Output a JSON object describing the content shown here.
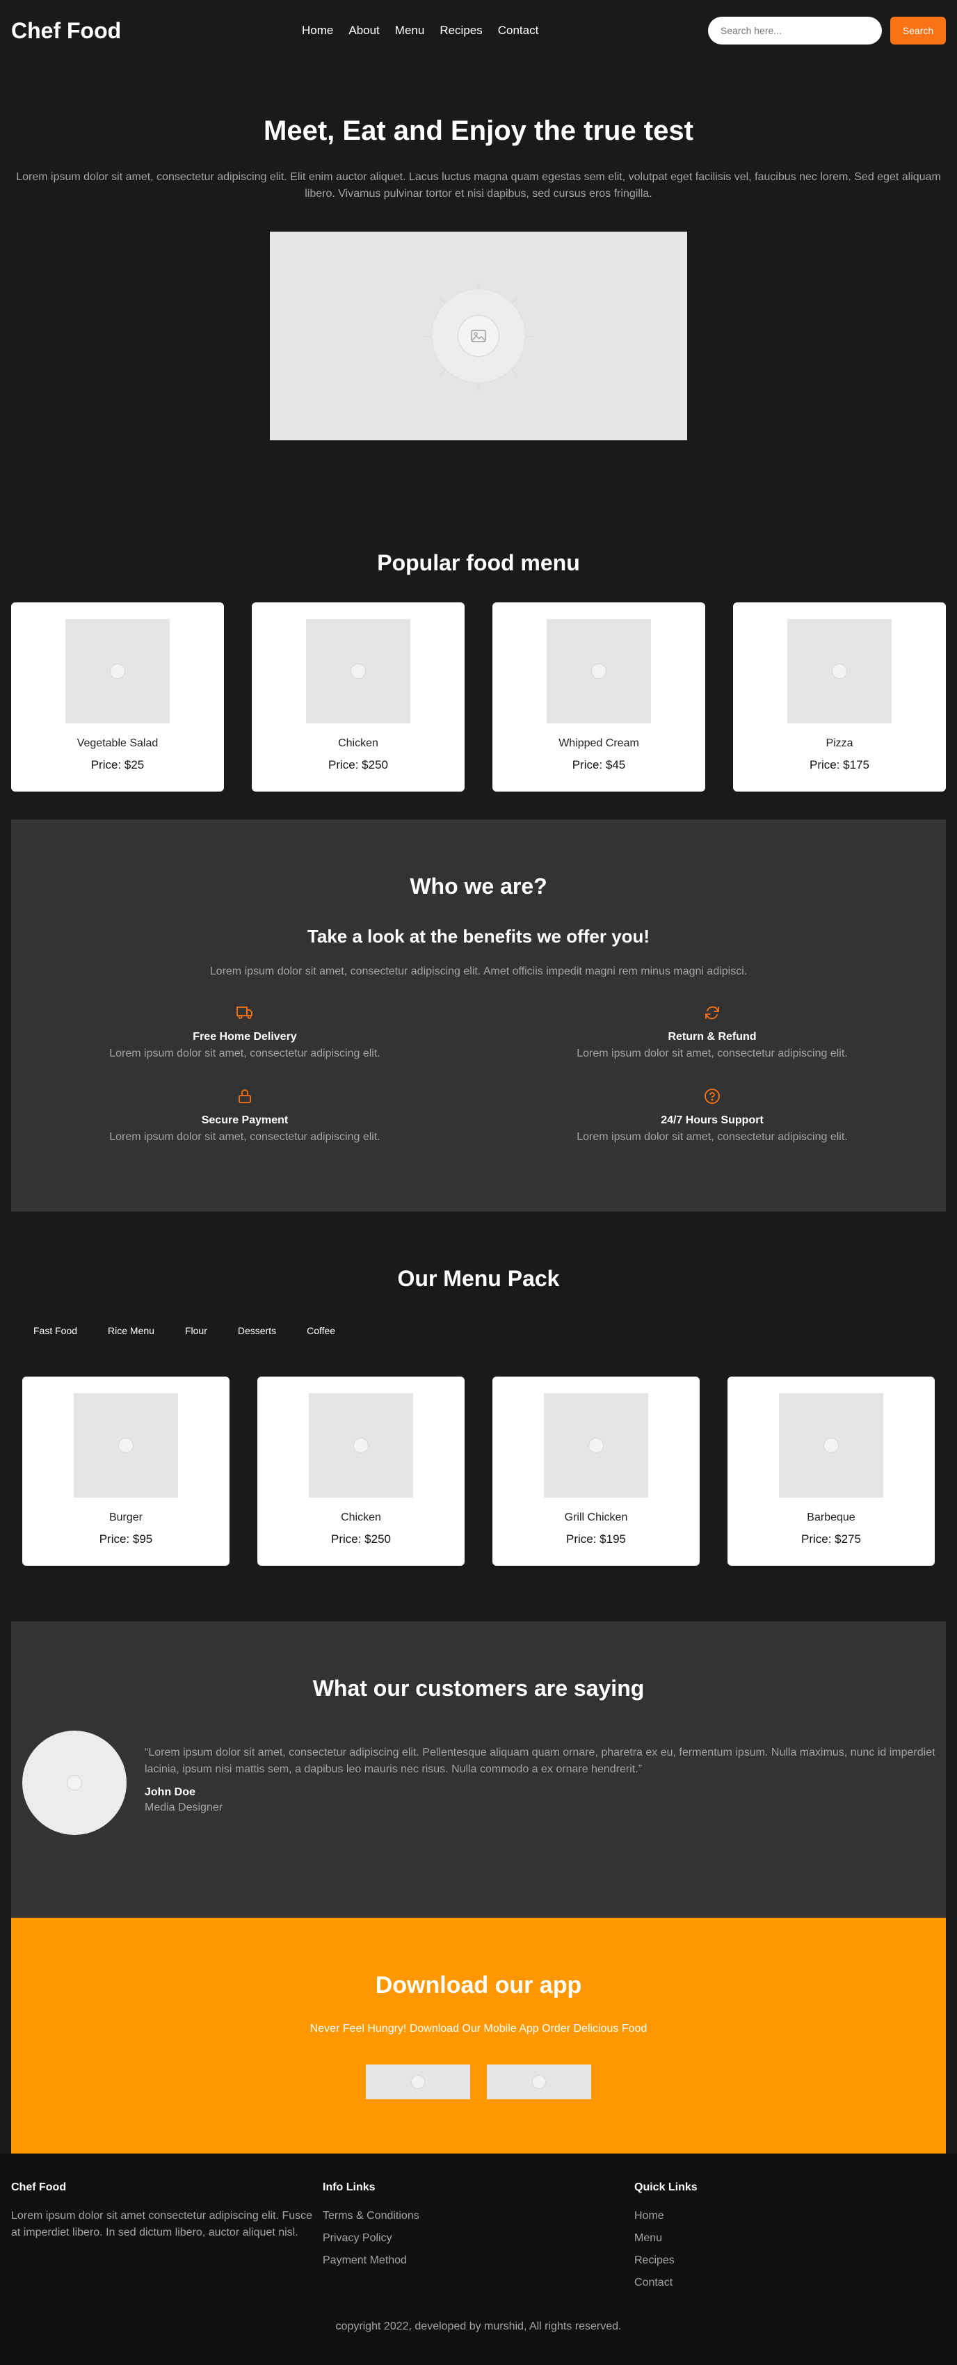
{
  "brand": "Chef Food",
  "nav": [
    "Home",
    "About",
    "Menu",
    "Recipes",
    "Contact"
  ],
  "search": {
    "placeholder": "Search here...",
    "button": "Search"
  },
  "hero": {
    "title": "Meet, Eat and Enjoy the true test",
    "text": "Lorem ipsum dolor sit amet, consectetur adipiscing elit. Elit enim auctor aliquet. Lacus luctus magna quam egestas sem elit, volutpat eget facilisis vel, faucibus nec lorem. Sed eget aliquam libero. Vivamus pulvinar tortor et nisi dapibus, sed cursus eros fringilla."
  },
  "popular": {
    "title": "Popular food menu",
    "items": [
      {
        "name": "Vegetable Salad",
        "price": "Price: $25"
      },
      {
        "name": "Chicken",
        "price": "Price: $250"
      },
      {
        "name": "Whipped Cream",
        "price": "Price: $45"
      },
      {
        "name": "Pizza",
        "price": "Price: $175"
      }
    ]
  },
  "who": {
    "title": "Who we are?",
    "subtitle": "Take a look at the benefits we offer you!",
    "lead": "Lorem ipsum dolor sit amet, consectetur adipiscing elit. Amet officiis impedit magni rem minus magni adipisci.",
    "accent": "#f97316",
    "benefits": [
      {
        "icon": "truck-icon",
        "title": "Free Home Delivery",
        "text": "Lorem ipsum dolor sit amet, consectetur adipiscing elit."
      },
      {
        "icon": "refresh-icon",
        "title": "Return & Refund",
        "text": "Lorem ipsum dolor sit amet, consectetur adipiscing elit."
      },
      {
        "icon": "lock-icon",
        "title": "Secure Payment",
        "text": "Lorem ipsum dolor sit amet, consectetur adipiscing elit."
      },
      {
        "icon": "help-circle-icon",
        "title": "24/7 Hours Support",
        "text": "Lorem ipsum dolor sit amet, consectetur adipiscing elit."
      }
    ]
  },
  "pack": {
    "title": "Our Menu Pack",
    "tabs": [
      "Fast Food",
      "Rice Menu",
      "Flour",
      "Desserts",
      "Coffee"
    ],
    "items": [
      {
        "name": "Burger",
        "price": "Price: $95"
      },
      {
        "name": "Chicken",
        "price": "Price: $250"
      },
      {
        "name": "Grill Chicken",
        "price": "Price: $195"
      },
      {
        "name": "Barbeque",
        "price": "Price: $275"
      }
    ]
  },
  "testimonial": {
    "title": "What our customers are saying",
    "quote": "“Lorem ipsum dolor sit amet, consectetur adipiscing elit. Pellentesque aliquam quam ornare, pharetra ex eu, fermentum ipsum. Nulla maximus, nunc id imperdiet lacinia, ipsum nisi mattis sem, a dapibus leo mauris nec risus. Nulla commodo a ex ornare hendrerit.”",
    "author": "John Doe",
    "role": "Media Designer"
  },
  "download": {
    "title": "Download our app",
    "text": "Never Feel Hungry! Download Our Mobile App Order Delicious Food",
    "color": "#ff9800"
  },
  "footer": {
    "col1": {
      "title": "Chef Food",
      "text": "Lorem ipsum dolor sit amet consectetur adipiscing elit. Fusce at imperdiet libero. In sed dictum libero, auctor aliquet nisl."
    },
    "col2": {
      "title": "Info Links",
      "links": [
        "Terms & Conditions",
        "Privacy Policy",
        "Payment Method"
      ]
    },
    "col3": {
      "title": "Quick Links",
      "links": [
        "Home",
        "Menu",
        "Recipes",
        "Contact"
      ]
    },
    "copyright": "copyright 2022, developed by murshid, All rights reserved."
  }
}
